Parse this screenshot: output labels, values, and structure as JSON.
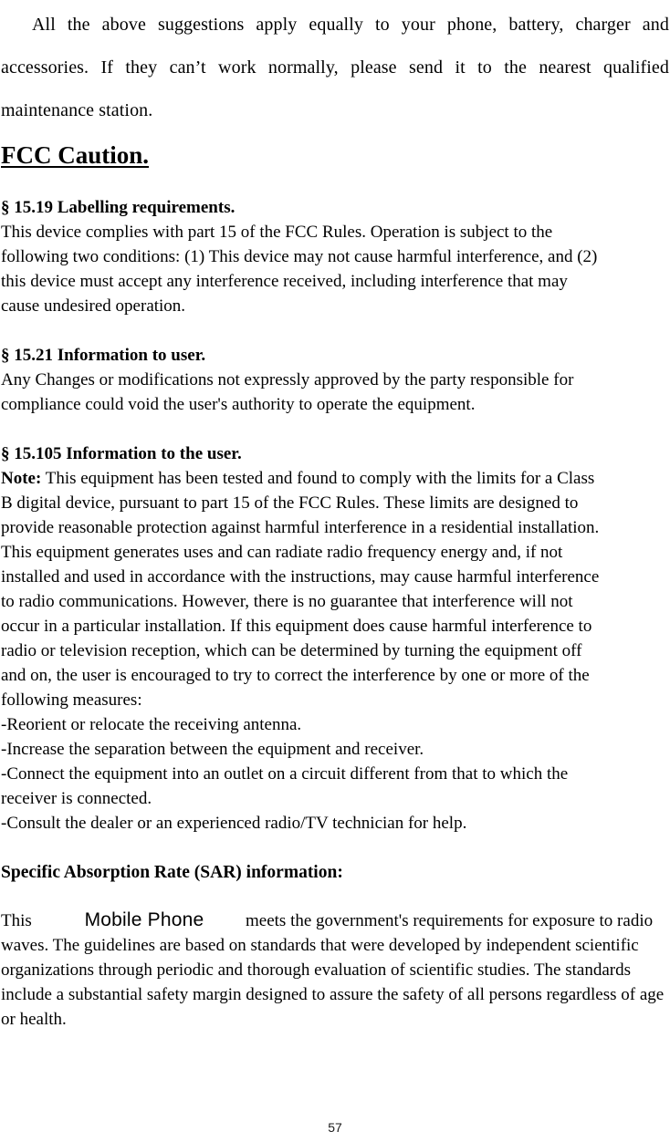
{
  "document": {
    "page_number": "57",
    "intro_paragraph": "All the above suggestions apply equally to your phone, battery, charger and accessories. If they can’t work normally, please send it to the nearest qualified maintenance station.",
    "heading": "FCC Caution."
  },
  "sections": [
    {
      "heading": "§ 15.19 Labelling requirements.",
      "lines": [
        "This device complies with part 15 of the FCC Rules. Operation is subject to the",
        "following two conditions: (1) This device may not cause harmful interference, and (2)",
        "this device must accept any interference received, including interference that may",
        "cause undesired operation."
      ]
    },
    {
      "heading": "§ 15.21 Information to user.",
      "lines": [
        "Any Changes or modifications not expressly approved by the party responsible for",
        "compliance could void the user's authority to operate the equipment."
      ]
    },
    {
      "heading": "§ 15.105 Information to the user.",
      "note_label": "Note:",
      "note_first_line": " This equipment has been tested and found to comply with the limits for a Class",
      "lines": [
        "B digital device, pursuant to part 15 of the FCC Rules. These limits are designed to",
        "provide reasonable protection against harmful interference in a residential installation.",
        "This equipment generates uses and can radiate radio frequency energy and, if not",
        "installed and used in accordance with the instructions, may cause harmful interference",
        "to radio communications. However, there is no guarantee that interference will not",
        "occur in a particular installation. If this equipment does cause harmful interference to",
        "radio or television reception, which can be determined by turning the equipment off",
        "and on, the user is encouraged to try to correct the interference by one or more of the",
        "following measures:",
        "-Reorient or relocate the receiving antenna.",
        "-Increase the separation between the equipment and receiver.",
        "-Connect the equipment into an outlet on a circuit different from that to which the",
        "receiver is connected.",
        "-Consult the dealer or an experienced radio/TV technician for help."
      ]
    }
  ],
  "sar": {
    "heading": "Specific Absorption Rate (SAR) information:",
    "lead_word": "This",
    "product_name": "Mobile Phone",
    "after_slot": "meets the government's requirements for exposure",
    "lines": [
      "to radio waves. The guidelines are based on standards that were developed by",
      "independent scientific organizations through periodic and thorough evaluation of",
      "scientific studies. The standards include a substantial safety margin designed to assure",
      "the safety of all persons regardless of age or health."
    ]
  }
}
